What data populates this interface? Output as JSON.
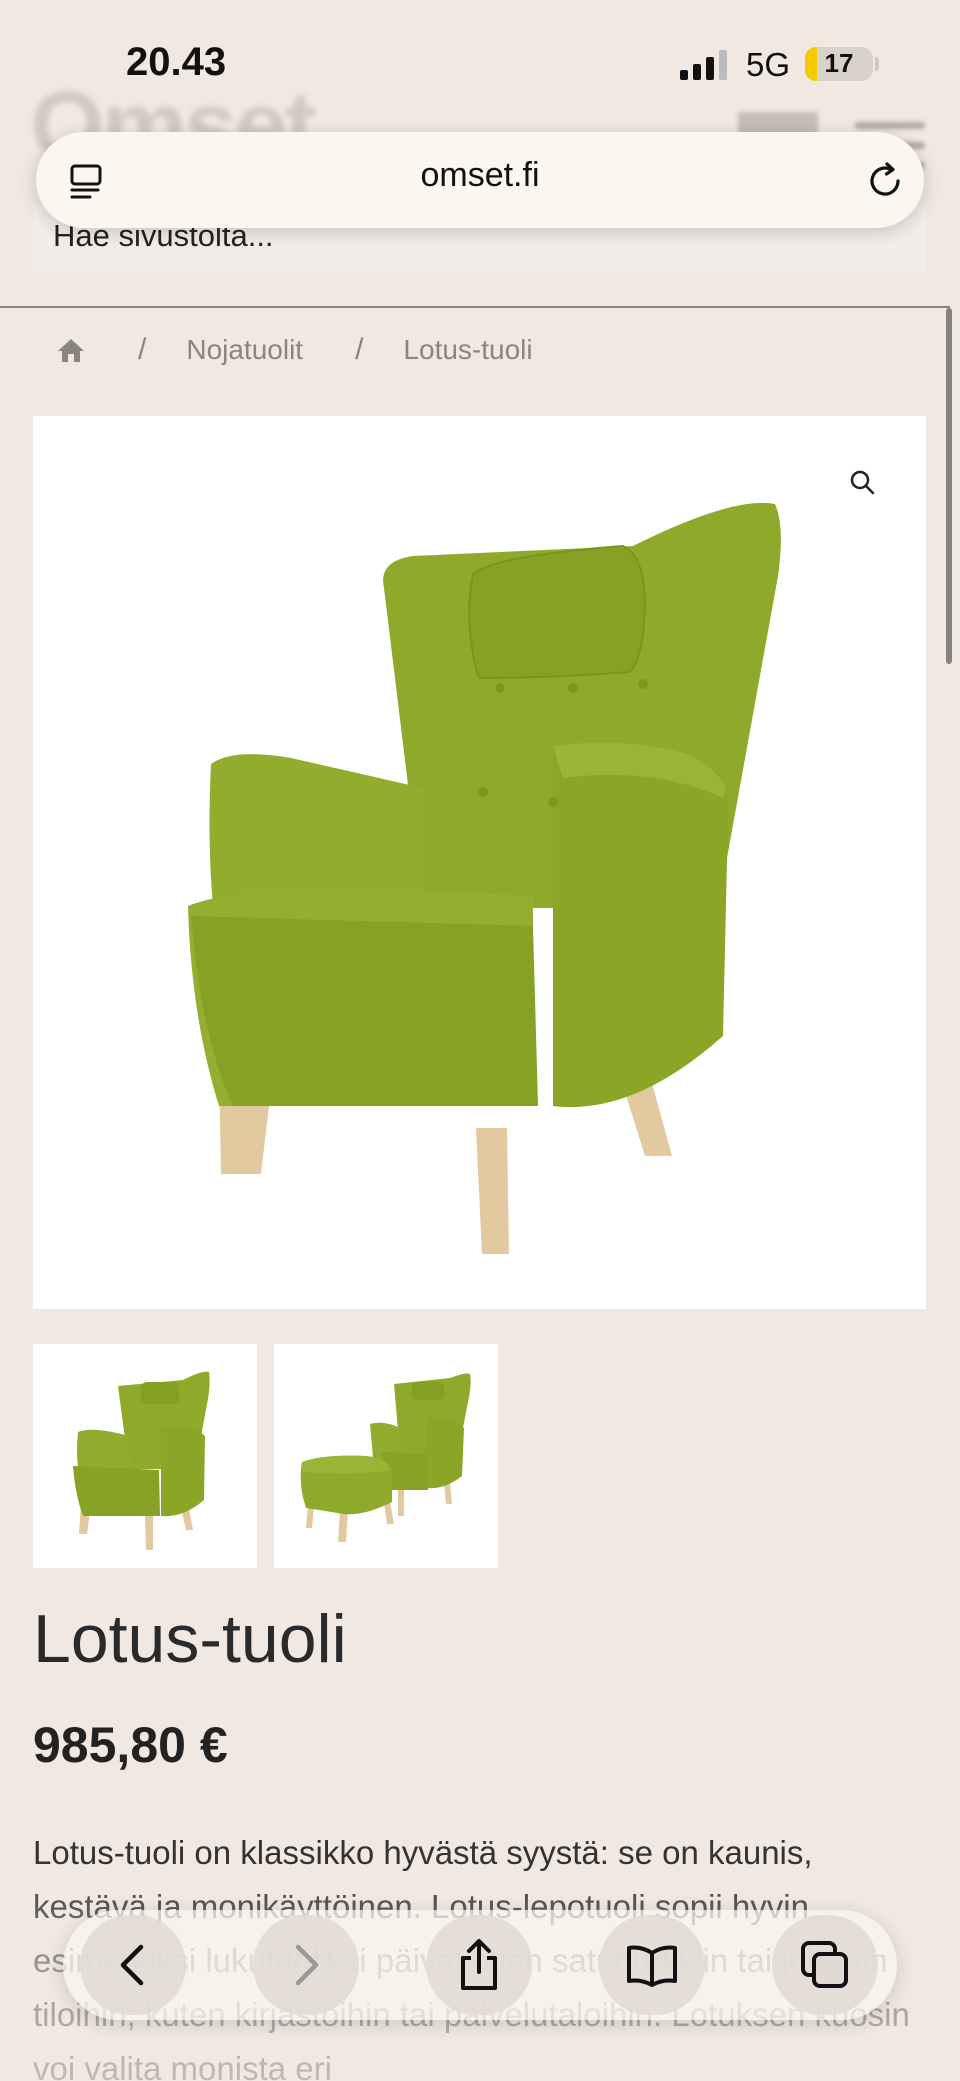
{
  "status_bar": {
    "time": "20.43",
    "network": "5G",
    "battery": "17",
    "battery_level": 0.17
  },
  "site_header": {
    "logo": "Omset",
    "search_placeholder": "Hae sivustolta..."
  },
  "browser": {
    "url": "omset.fi"
  },
  "breadcrumb": {
    "items": [
      "Nojatuolit",
      "Lotus-tuoli"
    ],
    "separator": "/"
  },
  "product": {
    "title": "Lotus-tuoli",
    "price": "985,80 €",
    "color": "#8faa2a",
    "description": "Lotus-tuoli on klassikko hyvästä syystä: se on kaunis, kestävä ja monikäyttöinen. Lotus-lepotuoli sopii hyvin esimerkiksi lukutuoliksi päiväkotien satunurkkiin tai julkisiin tiloihin, kuten kirjastoihin tai palvelutaloihin. Lotuksen kuosin voi valita monista eri"
  },
  "icons": {
    "tabs_overview": "tabs-overview-icon",
    "reload": "reload-icon",
    "home": "home-icon",
    "zoom": "zoom-icon",
    "back": "chevron-left-icon",
    "forward": "chevron-right-icon",
    "share": "share-icon",
    "bookmarks": "book-icon",
    "tabs": "tabs-icon"
  }
}
